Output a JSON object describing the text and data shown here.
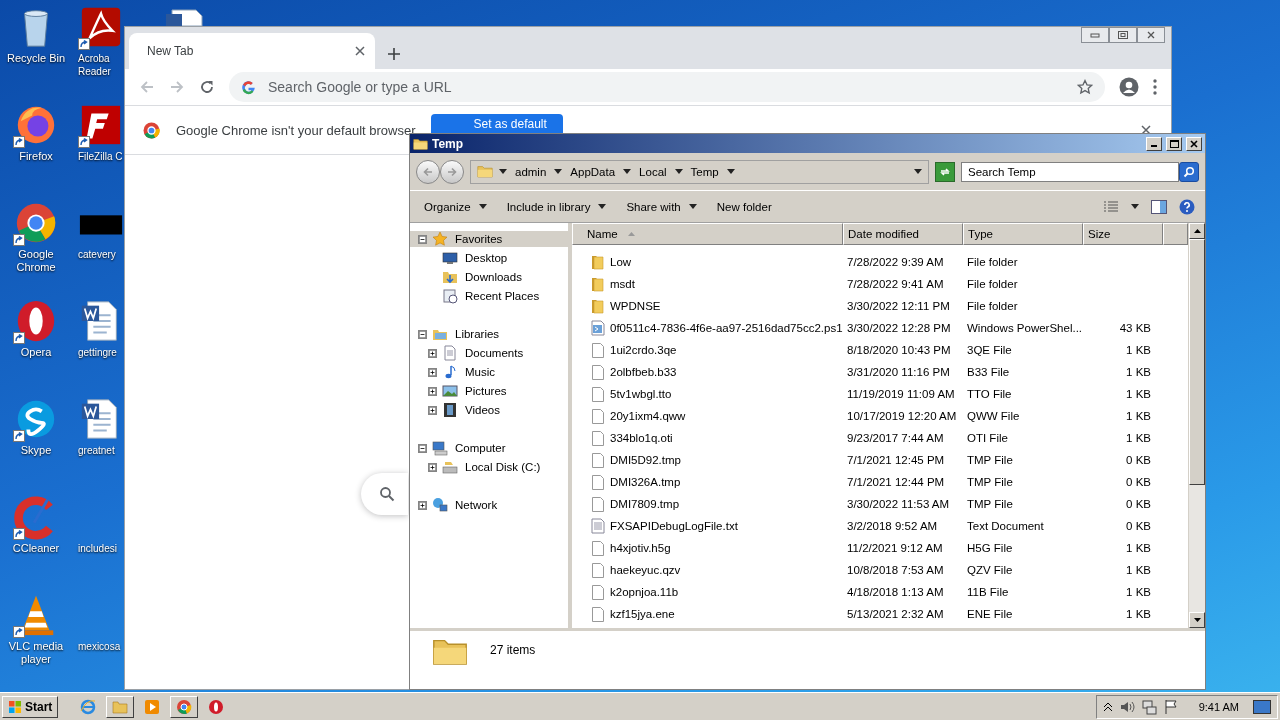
{
  "desktop": {
    "icons": [
      {
        "label": "Recycle Bin",
        "kind": "recycle"
      },
      {
        "label": "Firefox",
        "kind": "firefox"
      },
      {
        "label": "Google Chrome",
        "kind": "chrome"
      },
      {
        "label": "Opera",
        "kind": "opera"
      },
      {
        "label": "Skype",
        "kind": "skype"
      },
      {
        "label": "CCleaner",
        "kind": "ccleaner"
      },
      {
        "label": "VLC media player",
        "kind": "vlc"
      },
      {
        "label": "Acroba Reader",
        "kind": "acrobat"
      },
      {
        "label": "FileZilla C",
        "kind": "filezilla"
      },
      {
        "label": "catevery",
        "kind": "black"
      },
      {
        "label": "gettingre",
        "kind": "word"
      },
      {
        "label": "greatnet",
        "kind": "word"
      },
      {
        "label": "includesi",
        "kind": "blank"
      },
      {
        "label": "mexicosa",
        "kind": "blank"
      }
    ]
  },
  "browser": {
    "tabs": [
      {
        "title": "New Tab",
        "selected": true
      }
    ],
    "omnibox": {
      "placeholder": "Search Google or type a URL"
    },
    "infobar": {
      "message": "Google Chrome isn't your default browser",
      "button": "Set as default"
    }
  },
  "explorer": {
    "title": "Temp",
    "breadcrumb": [
      "admin",
      "AppData",
      "Local",
      "Temp"
    ],
    "search": {
      "placeholder": "Search Temp"
    },
    "commands": [
      {
        "label": "Organize",
        "menu": true
      },
      {
        "label": "Include in library",
        "menu": true
      },
      {
        "label": "Share with",
        "menu": true
      },
      {
        "label": "New folder",
        "menu": false
      }
    ],
    "tree": [
      {
        "label": "Favorites",
        "kind": "star",
        "selected": true,
        "expanded": true,
        "children": [
          {
            "label": "Desktop",
            "kind": "desktop",
            "selected": false
          },
          {
            "label": "Downloads",
            "kind": "downloads",
            "selected": false
          },
          {
            "label": "Recent Places",
            "kind": "recent",
            "selected": false
          }
        ]
      },
      {
        "label": "Libraries",
        "kind": "library",
        "selected": false,
        "expanded": true,
        "children": [
          {
            "label": "Documents",
            "kind": "documents",
            "selected": false,
            "expanded": false
          },
          {
            "label": "Music",
            "kind": "music",
            "selected": false,
            "expanded": false
          },
          {
            "label": "Pictures",
            "kind": "pictures",
            "selected": false,
            "expanded": false
          },
          {
            "label": "Videos",
            "kind": "videos",
            "selected": false,
            "expanded": false
          }
        ]
      },
      {
        "label": "Computer",
        "kind": "computer",
        "selected": false,
        "expanded": true,
        "children": [
          {
            "label": "Local Disk (C:)",
            "kind": "disk",
            "selected": false,
            "expanded": false
          }
        ]
      },
      {
        "label": "Network",
        "kind": "network",
        "selected": false,
        "expanded": false
      }
    ],
    "columns": [
      {
        "label": "Name",
        "sorted": true
      },
      {
        "label": "Date modified",
        "sorted": false
      },
      {
        "label": "Type",
        "sorted": false
      },
      {
        "label": "Size",
        "sorted": false
      }
    ],
    "rows": [
      {
        "name": "Low",
        "date": "7/28/2022 9:39 AM",
        "type": "File folder",
        "kind": "folder"
      },
      {
        "name": "msdt",
        "date": "7/28/2022 9:41 AM",
        "type": "File folder",
        "kind": "folder"
      },
      {
        "name": "WPDNSE",
        "date": "3/30/2022 12:11 PM",
        "type": "File folder",
        "kind": "folder"
      },
      {
        "name": "0f0511c4-7836-4f6e-aa97-2516dad75cc2.ps1",
        "date": "3/30/2022 12:28 PM",
        "type": "Windows PowerShel...",
        "size": "43 KB",
        "kind": "script"
      },
      {
        "name": "1ui2crdo.3qe",
        "date": "8/18/2020 10:43 PM",
        "type": "3QE File",
        "size": "1 KB",
        "kind": "file"
      },
      {
        "name": "2olbfbeb.b33",
        "date": "3/31/2020 11:16 PM",
        "type": "B33 File",
        "size": "1 KB",
        "kind": "file"
      },
      {
        "name": "5tv1wbgl.tto",
        "date": "11/19/2019 11:09 AM",
        "type": "TTO File",
        "size": "1 KB",
        "kind": "file"
      },
      {
        "name": "20y1ixm4.qww",
        "date": "10/17/2019 12:20 AM",
        "type": "QWW File",
        "size": "1 KB",
        "kind": "file"
      },
      {
        "name": "334blo1q.oti",
        "date": "9/23/2017 7:44 AM",
        "type": "OTI File",
        "size": "1 KB",
        "kind": "file"
      },
      {
        "name": "DMI5D92.tmp",
        "date": "7/1/2021 12:45 PM",
        "type": "TMP File",
        "size": "0 KB",
        "kind": "file"
      },
      {
        "name": "DMI326A.tmp",
        "date": "7/1/2021 12:44 PM",
        "type": "TMP File",
        "size": "0 KB",
        "kind": "file"
      },
      {
        "name": "DMI7809.tmp",
        "date": "3/30/2022 11:53 AM",
        "type": "TMP File",
        "size": "0 KB",
        "kind": "file"
      },
      {
        "name": "FXSAPIDebugLogFile.txt",
        "date": "3/2/2018 9:52 AM",
        "type": "Text Document",
        "size": "0 KB",
        "kind": "text"
      },
      {
        "name": "h4xjotiv.h5g",
        "date": "11/2/2021 9:12 AM",
        "type": "H5G File",
        "size": "1 KB",
        "kind": "file"
      },
      {
        "name": "haekeyuc.qzv",
        "date": "10/8/2018 7:53 AM",
        "type": "QZV File",
        "size": "1 KB",
        "kind": "file"
      },
      {
        "name": "k2opnjoa.11b",
        "date": "4/18/2018 1:13 AM",
        "type": "11B File",
        "size": "1 KB",
        "kind": "file"
      },
      {
        "name": "kzf15jya.ene",
        "date": "5/13/2021 2:32 AM",
        "type": "ENE File",
        "size": "1 KB",
        "kind": "file"
      }
    ],
    "status": {
      "count": "27 items"
    }
  },
  "taskbar": {
    "start": "Start",
    "apps": [
      {
        "kind": "ie",
        "open": false
      },
      {
        "kind": "explorer",
        "open": true
      },
      {
        "kind": "media",
        "open": false
      },
      {
        "kind": "chrome",
        "open": true
      },
      {
        "kind": "opera",
        "open": false
      }
    ],
    "clock": "9:41 AM"
  }
}
